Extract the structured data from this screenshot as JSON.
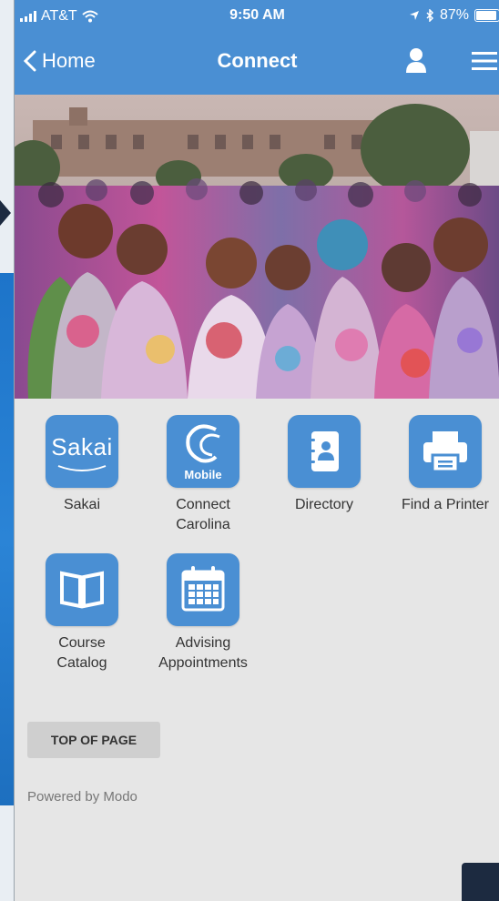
{
  "status_bar": {
    "carrier": "AT&T",
    "time": "9:50 AM",
    "battery": "87%"
  },
  "nav": {
    "back_label": "Home",
    "title": "Connect"
  },
  "tiles": [
    {
      "label": "Sakai",
      "icon": "sakai-logo-icon",
      "badge": "Sakai"
    },
    {
      "label": "Connect\nCarolina",
      "icon": "connect-carolina-icon",
      "badge": "Mobile"
    },
    {
      "label": "Directory",
      "icon": "address-book-icon"
    },
    {
      "label": "Find a Printer",
      "icon": "printer-icon"
    },
    {
      "label": "Course\nCatalog",
      "icon": "open-book-icon"
    },
    {
      "label": "Advising\nAppointments",
      "icon": "calendar-icon"
    }
  ],
  "footer": {
    "top_button": "TOP OF PAGE",
    "powered_by": "Powered by Modo"
  },
  "colors": {
    "brand_blue": "#4a8fd3",
    "page_bg": "#e6e6e6",
    "dark_navy": "#1c2a40"
  }
}
